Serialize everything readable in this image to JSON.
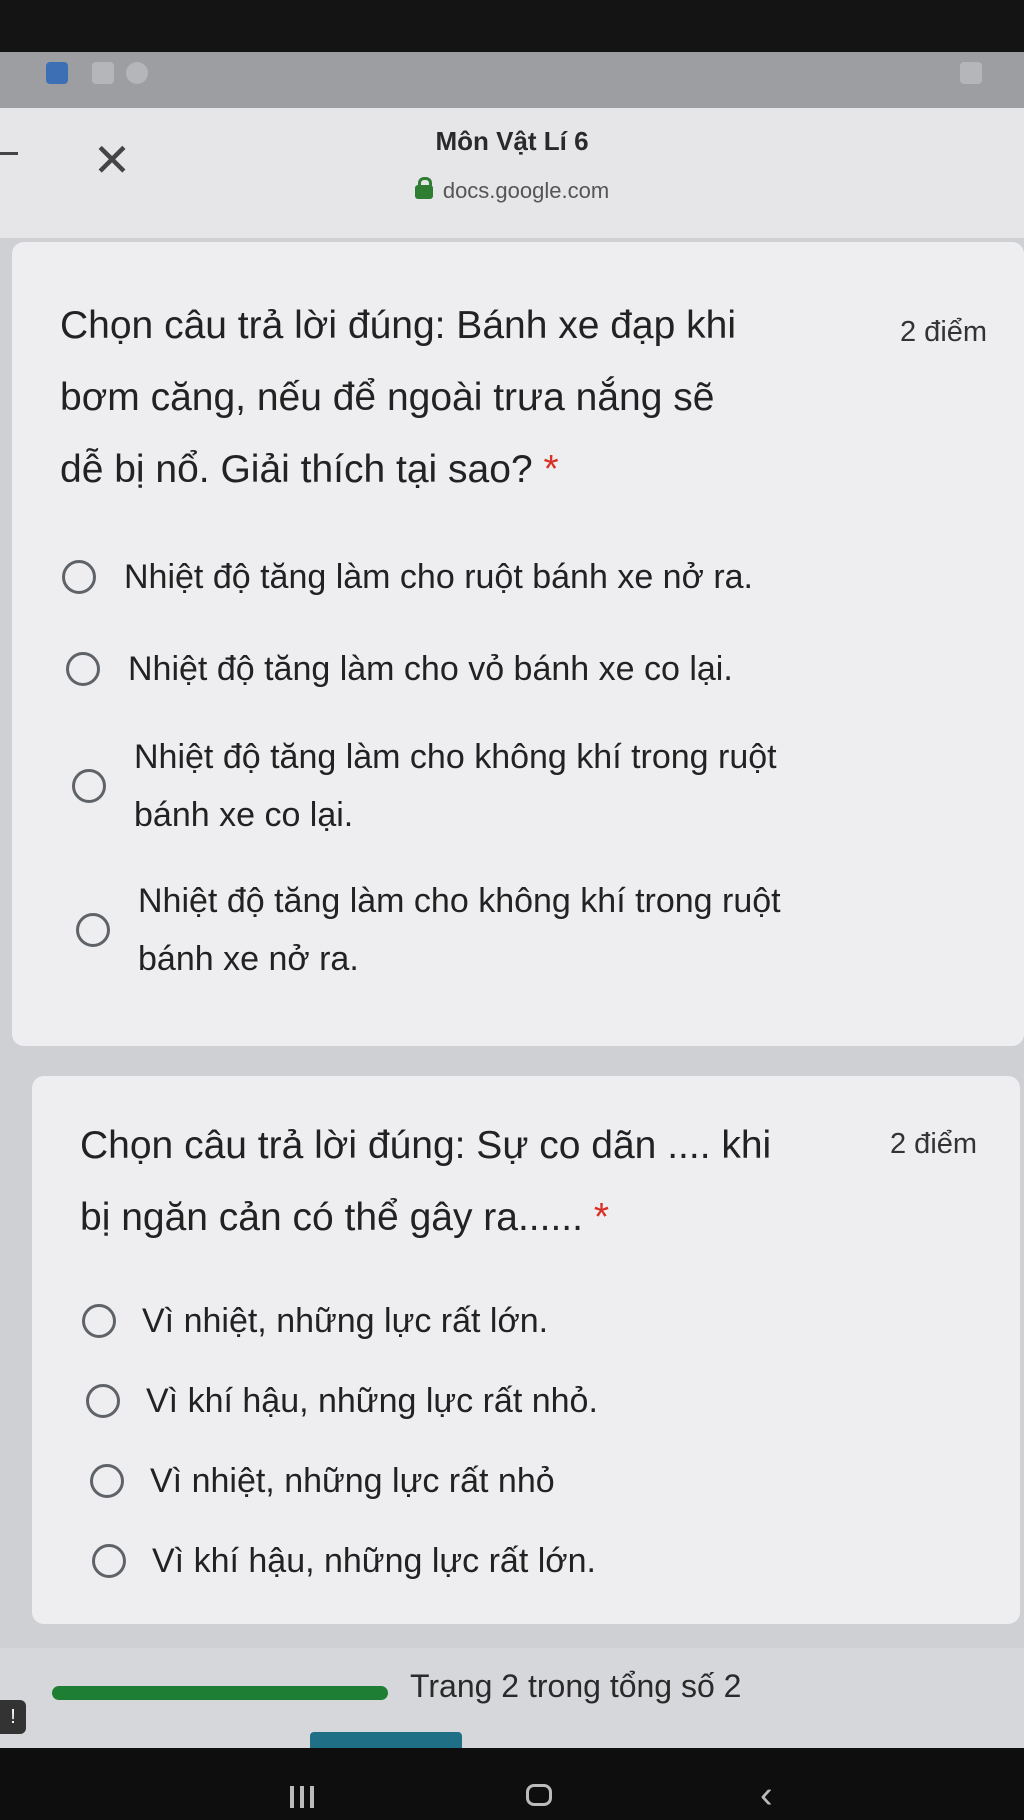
{
  "header": {
    "title": "Môn Vật Lí 6",
    "url": "docs.google.com"
  },
  "questions": [
    {
      "lines": [
        "Chọn câu trả lời đúng: Bánh xe đạp khi",
        "bơm căng, nếu để ngoài trưa nắng sẽ",
        "dễ bị nổ. Giải thích tại sao?"
      ],
      "required_mark": "*",
      "points": "2 điểm",
      "options": [
        [
          "Nhiệt độ tăng làm cho ruột bánh xe nở ra."
        ],
        [
          "Nhiệt độ tăng làm cho vỏ bánh xe co lại."
        ],
        [
          "Nhiệt độ tăng làm cho không khí trong ruột",
          "bánh xe co lại."
        ],
        [
          "Nhiệt độ tăng làm cho không khí trong ruột",
          "bánh xe nở ra."
        ]
      ]
    },
    {
      "lines": [
        "Chọn câu trả lời đúng: Sự co dãn .... khi",
        "bị ngăn cản có thể gây ra......"
      ],
      "required_mark": "*",
      "points": "2 điểm",
      "options": [
        [
          "Vì nhiệt, những lực rất lớn."
        ],
        [
          "Vì khí hậu, những lực rất nhỏ."
        ],
        [
          "Vì nhiệt, những lực rất nhỏ"
        ],
        [
          "Vì khí hậu, những lực rất lớn."
        ]
      ]
    }
  ],
  "footer": {
    "page_counter": "Trang 2 trong tổng số 2",
    "progress": 1.0,
    "feedback_icon": "!"
  },
  "colors": {
    "progress": "#1e7e34",
    "required": "#d93025",
    "lock": "#2e7d32"
  },
  "icons": {
    "close": "close-icon",
    "lock": "lock-icon",
    "nav_recent": "recent-apps-icon",
    "nav_home": "home-icon",
    "nav_back": "back-icon"
  }
}
